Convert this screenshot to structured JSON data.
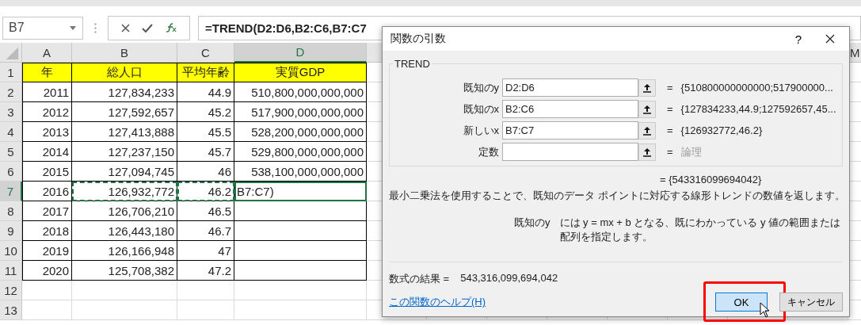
{
  "formula_bar": {
    "name_box": "B7",
    "formula": "=TREND(D2:D6,B2:C6,B7:C7"
  },
  "sheet": {
    "columns": [
      {
        "label": "A",
        "selected": false
      },
      {
        "label": "B",
        "selected": false
      },
      {
        "label": "C",
        "selected": false
      },
      {
        "label": "D",
        "selected": true
      },
      {
        "label": "M",
        "selected": false
      }
    ],
    "rows": [
      {
        "number": "1",
        "selected": false,
        "kind": "header",
        "cells": [
          "年",
          "総人口",
          "平均年齢",
          "実質GDP"
        ]
      },
      {
        "number": "2",
        "selected": false,
        "kind": "data",
        "cells": [
          "2011",
          "127,834,233",
          "44.9",
          "510,800,000,000,000"
        ]
      },
      {
        "number": "3",
        "selected": false,
        "kind": "data",
        "cells": [
          "2012",
          "127,592,657",
          "45.2",
          "517,900,000,000,000"
        ]
      },
      {
        "number": "4",
        "selected": false,
        "kind": "data",
        "cells": [
          "2013",
          "127,413,888",
          "45.5",
          "528,200,000,000,000"
        ]
      },
      {
        "number": "5",
        "selected": false,
        "kind": "data",
        "cells": [
          "2014",
          "127,237,150",
          "45.7",
          "529,800,000,000,000"
        ]
      },
      {
        "number": "6",
        "selected": false,
        "kind": "data",
        "cells": [
          "2015",
          "127,094,745",
          "46",
          "538,100,000,000,000"
        ]
      },
      {
        "number": "7",
        "selected": true,
        "kind": "data",
        "cells": [
          "2016",
          {
            "text": "126,932,772",
            "in_copy_range": true,
            "active": false
          },
          {
            "text": "46.2",
            "in_copy_range": true,
            "active": false
          },
          {
            "text": "B7:C7)",
            "in_copy_range": false,
            "active": true
          }
        ]
      },
      {
        "number": "8",
        "selected": false,
        "kind": "data",
        "cells": [
          "2017",
          "126,706,210",
          "46.5"
        ]
      },
      {
        "number": "9",
        "selected": false,
        "kind": "data",
        "cells": [
          "2018",
          "126,443,180",
          "46.7"
        ]
      },
      {
        "number": "10",
        "selected": false,
        "kind": "data",
        "cells": [
          "2019",
          "126,166,948",
          "47"
        ]
      },
      {
        "number": "11",
        "selected": false,
        "kind": "data",
        "cells": [
          "2020",
          "125,708,382",
          "47.2"
        ]
      },
      {
        "number": "12",
        "selected": false,
        "kind": "empty"
      },
      {
        "number": "13",
        "selected": false,
        "kind": "empty"
      }
    ]
  },
  "dialog": {
    "title": "関数の引数",
    "help": "?",
    "function_name": "TREND",
    "arguments": [
      {
        "label": "既知のy",
        "value": "D2:D6",
        "result": "{510800000000000;517900000...",
        "kind": "value"
      },
      {
        "label": "既知のx",
        "value": "B2:C6",
        "result": "{127834233,44.9;127592657,45...",
        "kind": "value"
      },
      {
        "label": "新しいx",
        "value": "B7:C7",
        "result": "{126932772,46.2}",
        "kind": "value"
      },
      {
        "label": "定数",
        "result": "論理",
        "kind": "hint"
      }
    ],
    "equals": "=",
    "computed_result": "= {543316099694042}",
    "description": "最小二乗法を使用することで、既知のデータ ポイントに対応する線形トレンドの数値を返します。",
    "argument_help": {
      "label": "既知のy",
      "text": "には y = mx + b となる、既にわかっている y 値の範囲または配列を指定します。"
    },
    "formula_result_label": "数式の結果 =",
    "formula_result": "543,316,099,694,042",
    "help_link": "この関数のヘルプ(H)",
    "buttons": [
      {
        "label": "OK",
        "kind": "primary",
        "highlighted": true
      },
      {
        "label": "キャンセル",
        "kind": "secondary",
        "highlighted": false
      }
    ]
  }
}
